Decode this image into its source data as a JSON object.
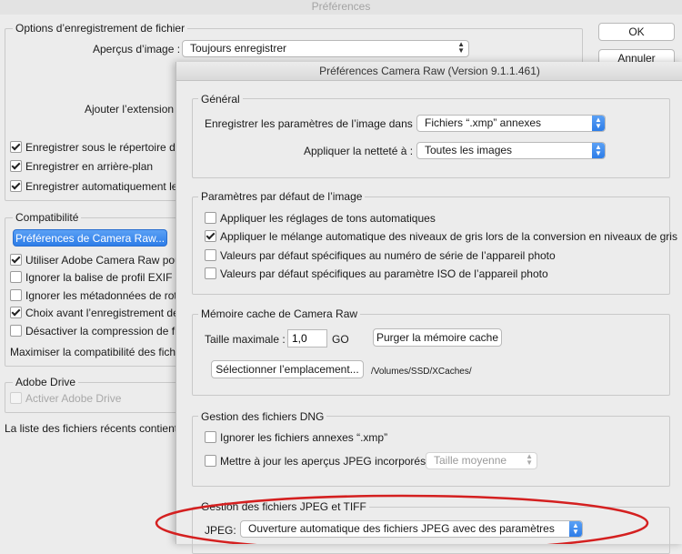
{
  "app": {
    "title": "Préférences"
  },
  "main": {
    "ok_label": "OK",
    "cancel_label": "Annuler",
    "save_group": {
      "title": "Options d’enregistrement de fichier",
      "previews_label": "Aperçus d’image :",
      "previews_value": "Toujours enregistrer",
      "extension_label": "Ajouter l’extension :",
      "checks": [
        {
          "label": "Enregistrer sous le répertoire d'o",
          "checked": true
        },
        {
          "label": "Enregistrer en arrière-plan",
          "checked": true
        },
        {
          "label": "Enregistrer automatiquement les",
          "checked": true
        }
      ]
    },
    "compat_group": {
      "title": "Compatibilité",
      "camera_raw_button": "Préférences de Camera Raw...",
      "checks": [
        {
          "label": "Utiliser Adobe Camera Raw pour",
          "checked": true
        },
        {
          "label": "Ignorer la balise de profil EXIF",
          "checked": false
        },
        {
          "label": "Ignorer les métadonnées de rota",
          "checked": false
        },
        {
          "label": "Choix avant l’enregistrement des",
          "checked": true
        },
        {
          "label": "Désactiver la compression de fic",
          "checked": false
        }
      ],
      "maximize_label": "Maximiser la compatibilité des fichi"
    },
    "adobe_drive": {
      "title": "Adobe Drive",
      "check_label": "Activer Adobe Drive",
      "checked": false
    },
    "recent_label": "La liste des fichiers récents contient :"
  },
  "dialog": {
    "title": "Préférences Camera Raw  (Version 9.1.1.461)",
    "general": {
      "title": "Général",
      "save_settings_label": "Enregistrer les paramètres de l’image dans :",
      "save_settings_value": "Fichiers “.xmp” annexes",
      "sharpen_label": "Appliquer la netteté à :",
      "sharpen_value": "Toutes les images"
    },
    "defaults": {
      "title": "Paramètres par défaut de l’image",
      "checks": [
        {
          "label": "Appliquer les réglages de tons automatiques",
          "checked": false
        },
        {
          "label": "Appliquer le mélange automatique des niveaux de gris lors de la conversion en niveaux de gris",
          "checked": true
        },
        {
          "label": "Valeurs par défaut spécifiques au numéro de série de l’appareil photo",
          "checked": false
        },
        {
          "label": "Valeurs par défaut spécifiques au paramètre ISO de l’appareil photo",
          "checked": false
        }
      ]
    },
    "cache": {
      "title": "Mémoire cache de Camera Raw",
      "max_size_label": "Taille maximale :",
      "max_size_value": "1,0",
      "unit": "GO",
      "purge_button": "Purger la mémoire cache",
      "select_location_button": "Sélectionner l’emplacement...",
      "path": "/Volumes/SSD/XCaches/"
    },
    "dng": {
      "title": "Gestion des fichiers DNG",
      "ignore_label": "Ignorer les fichiers annexes “.xmp”",
      "ignore_checked": false,
      "update_label": "Mettre à jour les aperçus JPEG incorporés :",
      "update_checked": false,
      "update_value": "Taille moyenne"
    },
    "jpeg": {
      "title": "Gestion des fichiers JPEG et TIFF",
      "jpeg_label": "JPEG:",
      "jpeg_value": "Ouverture automatique des fichiers JPEG avec des paramètres"
    }
  },
  "colors": {
    "highlight_ellipse": "#d42020",
    "accent": "#2d7de8"
  }
}
